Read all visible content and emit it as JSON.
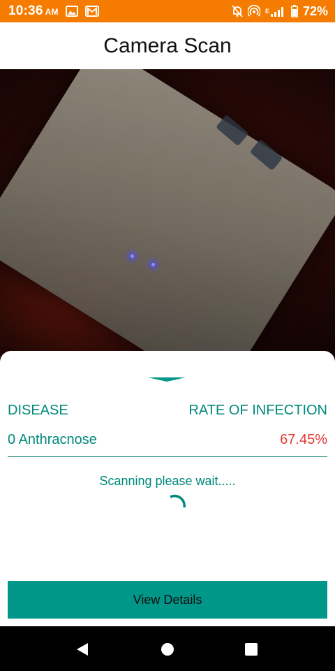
{
  "status_bar": {
    "time": "10:36",
    "ampm": "AM",
    "battery_percent": "72%",
    "icons": [
      "image-icon",
      "gmail-icon",
      "mute-icon",
      "hotspot-icon",
      "signal-icon",
      "battery-icon"
    ],
    "network_label": "E",
    "background_color": "#f57c00"
  },
  "app_bar": {
    "title": "Camera Scan"
  },
  "sheet": {
    "column_disease": "DISEASE",
    "column_rate": "RATE OF INFECTION",
    "result": {
      "disease": "0 Anthracnose",
      "rate": "67.45%"
    },
    "scan_status": "Scanning please wait.....",
    "details_button": "View Details",
    "accent_color": "#009688",
    "rate_color": "#e53935"
  },
  "nav_bar": {
    "icons": [
      "back-icon",
      "home-icon",
      "recents-icon"
    ]
  }
}
